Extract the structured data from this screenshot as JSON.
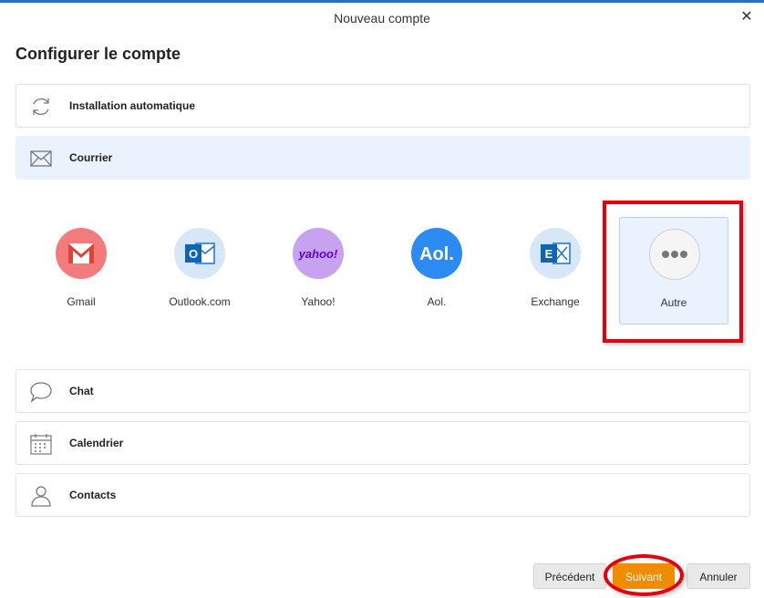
{
  "window": {
    "title": "Nouveau compte",
    "close_label": "✕"
  },
  "page": {
    "heading": "Configurer le compte"
  },
  "rows": {
    "auto_setup": "Installation automatique",
    "mail": "Courrier",
    "chat": "Chat",
    "calendar": "Calendrier",
    "contacts": "Contacts"
  },
  "providers": [
    {
      "label": "Gmail",
      "icon": "gmail-icon",
      "color": "#f47b7b"
    },
    {
      "label": "Outlook.com",
      "icon": "outlook-icon",
      "color": "#d6e8f7"
    },
    {
      "label": "Yahoo!",
      "icon": "yahoo-icon",
      "color": "#c7a2f0",
      "glyph": "yahoo!"
    },
    {
      "label": "Aol.",
      "icon": "aol-icon",
      "color": "#2b8bf2",
      "glyph": "Aol."
    },
    {
      "label": "Exchange",
      "icon": "exchange-icon",
      "color": "#d6e8f7"
    },
    {
      "label": "Autre",
      "icon": "more-icon",
      "color": "#f5f5f5",
      "selected": true
    }
  ],
  "buttons": {
    "previous": "Précédent",
    "next": "Suivant",
    "cancel": "Annuler"
  },
  "colors": {
    "accent": "#f08c00",
    "selection": "#eaf2fd",
    "annotation": "#e3000f"
  }
}
